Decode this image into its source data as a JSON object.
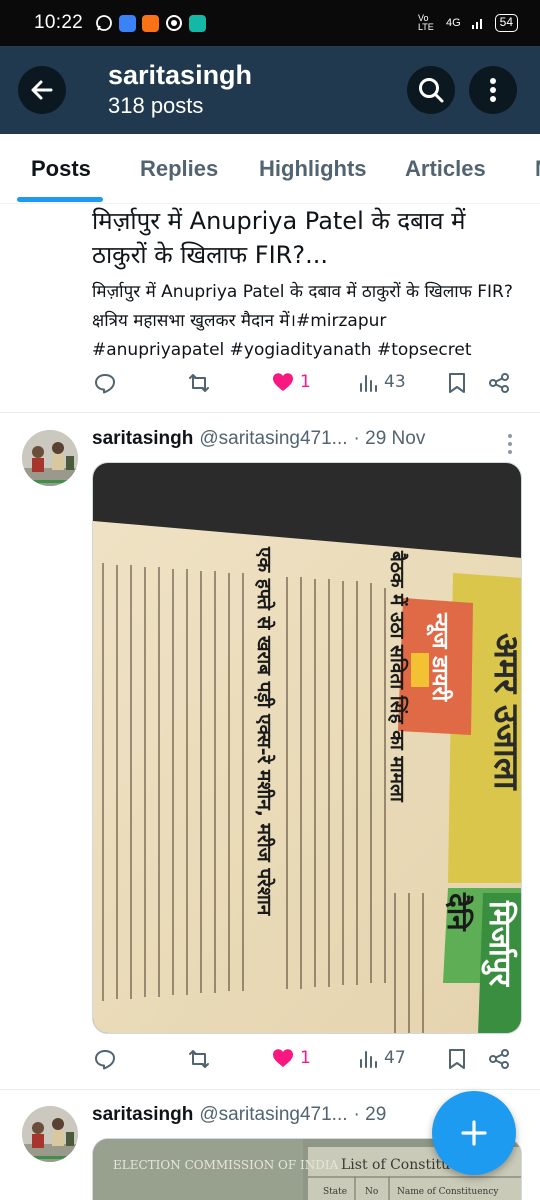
{
  "status_bar": {
    "time": "10:22",
    "network": "4G",
    "volte": "Vo LTE",
    "battery": "54"
  },
  "header": {
    "title": "saritasingh",
    "subtitle": "318 posts",
    "back_icon": "arrow-left-icon",
    "search_icon": "search-icon",
    "more_icon": "more-vertical-icon"
  },
  "tabs": [
    "Posts",
    "Replies",
    "Highlights",
    "Articles",
    "M"
  ],
  "active_tab": "Posts",
  "post1": {
    "headline": "मिर्ज़ापुर में Anupriya Patel के दबाव में ठाकुरों के खिलाफ FIR?...",
    "text": "मिर्ज़ापुर में Anupriya Patel के दबाव में ठाकुरों के खिलाफ FIR? क्षत्रिय महासभा खुलकर मैदान में।#mirzapur #anupriyapatel #yogiadityanath #topsecret",
    "replies": "",
    "reposts": "",
    "likes": "1",
    "views": "43"
  },
  "post2": {
    "name": "saritasingh",
    "handle": "@saritasing471...",
    "date": "· 29 Nov",
    "likes": "1",
    "views": "47",
    "media_texts": {
      "masthead": "अमर उजाला",
      "city": "मिर्जापुर",
      "brand": "न्यूज डायरी",
      "headline1": "बैठक में उठा सविता सिंह का मामला",
      "headline2": "एक हफ्ते से खराब पड़ी एक्स-रे मशीन, मरीज परेशान",
      "side": "दैनि"
    }
  },
  "post3": {
    "name": "saritasingh",
    "handle": "@saritasing471...",
    "date": "· 29",
    "media_texts": {
      "left": "ELECTION COMMISSION OF INDIA",
      "right": "List of Constituen",
      "col1": "State",
      "col2": "No",
      "col3": "Name of Constituency"
    }
  },
  "colors": {
    "header_bg": "#20394f",
    "accent": "#1d9bf0",
    "like": "#f91880",
    "muted": "#536471"
  },
  "fab_icon": "plus-icon"
}
